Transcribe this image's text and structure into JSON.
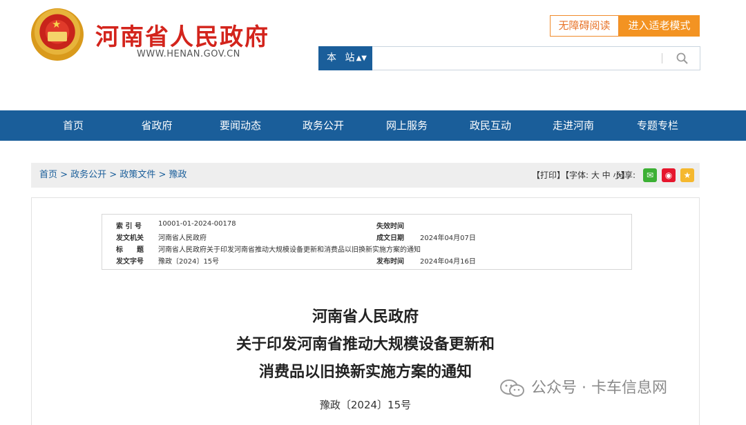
{
  "header": {
    "site_title": "河南省人民政府",
    "site_url": "WWW.HENAN.GOV.CN",
    "access_button": "无障碍阅读",
    "elder_button": "进入适老模式",
    "search": {
      "scope": "本 站",
      "scope_arrows": "▲▼",
      "placeholder": ""
    }
  },
  "nav": {
    "items": [
      "首页",
      "省政府",
      "要闻动态",
      "政务公开",
      "网上服务",
      "政民互动",
      "走进河南",
      "专题专栏"
    ]
  },
  "breadcrumb": {
    "text": "首页 > 政务公开 > 政策文件 > 豫政"
  },
  "tools": {
    "text": "【打印】【字体: 大 中 小】",
    "share_label": "分享:"
  },
  "meta": {
    "index_label": "索 引 号",
    "index_value": "10001-01-2024-00178",
    "effective_label": "失效时间",
    "effective_value": "",
    "issuer_label": "发文机关",
    "issuer_value": "河南省人民政府",
    "created_label": "成文日期",
    "created_value": "2024年04月07日",
    "title_label": "标　　题",
    "title_value": "河南省人民政府关于印发河南省推动大规模设备更新和消费品以旧换新实施方案的通知",
    "docno_label": "发文字号",
    "docno_value": "豫政〔2024〕15号",
    "published_label": "发布时间",
    "published_value": "2024年04月16日"
  },
  "document": {
    "title_lines": [
      "河南省人民政府",
      "关于印发河南省推动大规模设备更新和",
      "消费品以旧换新实施方案的通知"
    ],
    "doc_number": "豫政〔2024〕15号"
  },
  "watermark": {
    "text": "公众号 · 卡车信息网"
  },
  "colors": {
    "brand_red": "#d3241c",
    "nav_blue": "#1a5e9a",
    "elder_orange": "#f39322",
    "wechat_green": "#3cb034",
    "weibo_red": "#e6162d",
    "star_yellow": "#f5b82e"
  }
}
